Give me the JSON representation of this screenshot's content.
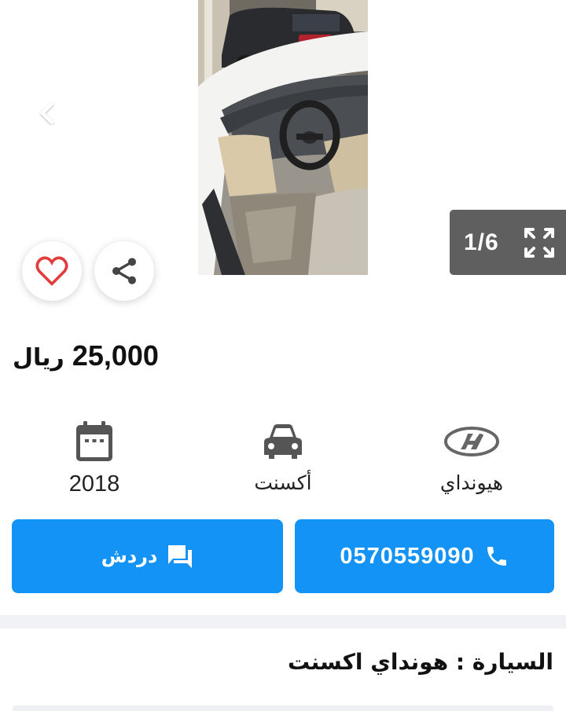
{
  "gallery": {
    "counter": "1/6",
    "prev_icon": "chevron-left-icon",
    "next_icon": "chevron-right-icon",
    "fullscreen_icon": "fullscreen-icon",
    "favorite_icon": "heart-outline-icon",
    "share_icon": "share-icon"
  },
  "price": {
    "amount": "25,000",
    "currency": "ريال"
  },
  "specs": {
    "year": {
      "icon": "calendar-icon",
      "label": "2018"
    },
    "model": {
      "icon": "car-icon",
      "label": "أكسنت"
    },
    "make": {
      "icon": "hyundai-logo-icon",
      "label": "هيونداي"
    }
  },
  "actions": {
    "chat_label": "دردش",
    "chat_icon": "chat-icon",
    "call_label": "0570559090",
    "call_icon": "phone-icon"
  },
  "listing": {
    "title": "السيارة : هونداي اكسنت"
  },
  "colors": {
    "primary": "#1393f5",
    "heart": "#e23b3b",
    "overlay": "#5f5f5f",
    "icon_gray": "#555555"
  }
}
